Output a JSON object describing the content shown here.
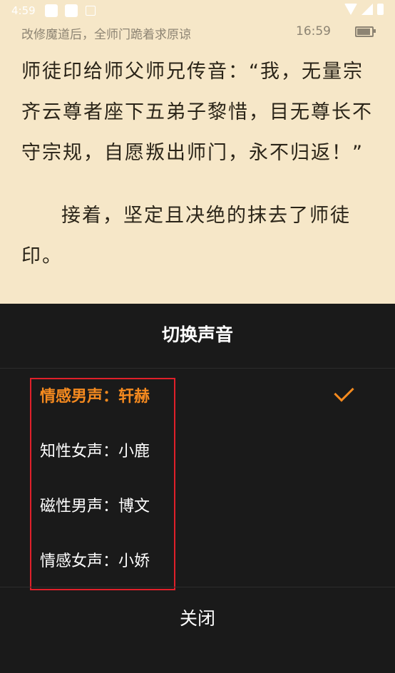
{
  "status_bar": {
    "time": "4:59"
  },
  "reader": {
    "chapter_title": "改修魔道后，全师门跪着求原谅",
    "clock": "16:59",
    "paragraphs": [
      "师徒印给师父师兄传音：“我，无量宗齐云尊者座下五弟子黎惜，目无尊长不守宗规，自愿叛出师门，永不归返！”",
      "接着，坚定且决绝的抹去了师徒印。"
    ]
  },
  "voice_sheet": {
    "title": "切换声音",
    "options": [
      {
        "label": "情感男声：轩赫",
        "selected": true
      },
      {
        "label": "知性女声：小鹿",
        "selected": false
      },
      {
        "label": "磁性男声：博文",
        "selected": false
      },
      {
        "label": "情感女声：小娇",
        "selected": false
      }
    ],
    "close_label": "关闭"
  },
  "colors": {
    "reader_bg": "#f6e7c8",
    "sheet_bg": "#1a1a1a",
    "accent": "#f58a1f",
    "highlight": "#e0202a"
  }
}
